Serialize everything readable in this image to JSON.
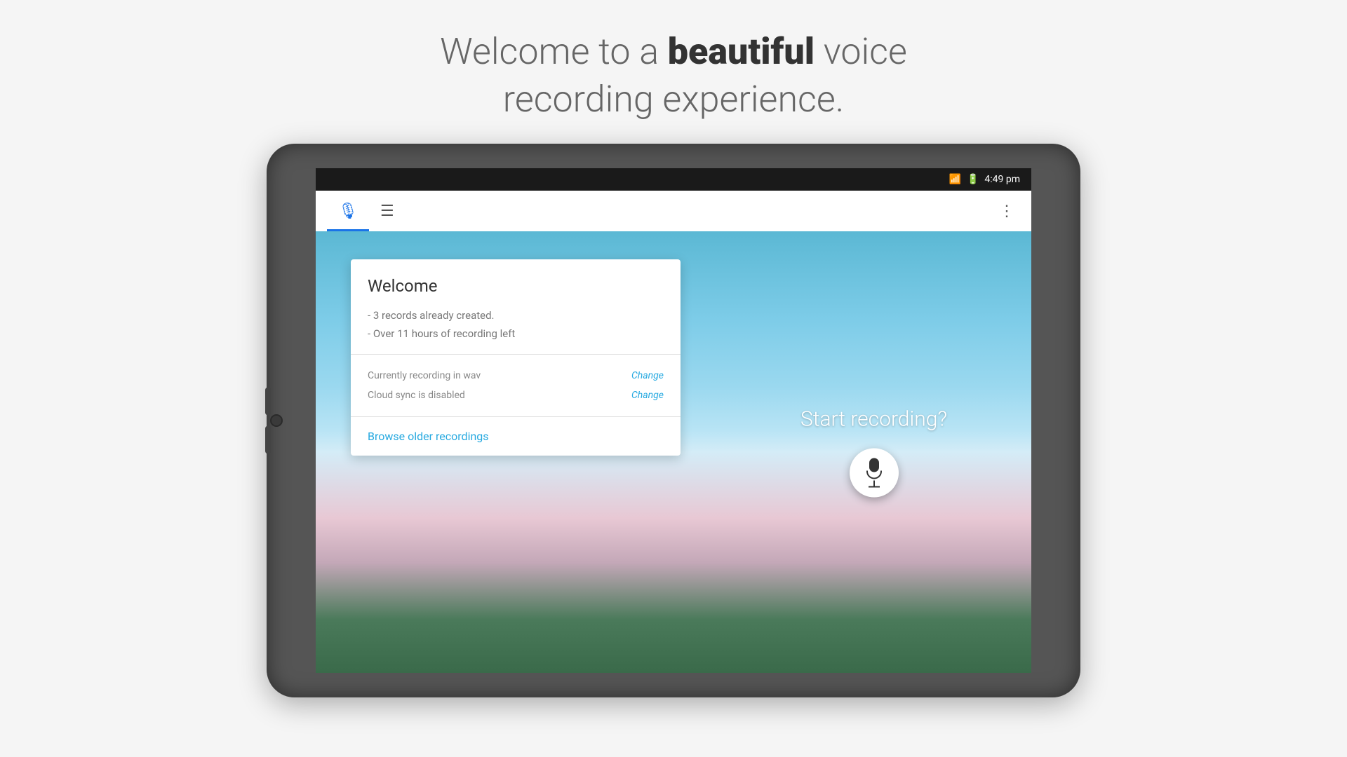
{
  "header": {
    "line1_pre": "Welcome to a ",
    "line1_bold": "beautiful",
    "line1_post": " voice",
    "line2": "recording experience."
  },
  "status_bar": {
    "time": "4:49 pm",
    "wifi_icon": "wifi",
    "battery_icon": "battery"
  },
  "app_bar": {
    "tab_record_label": "Record tab",
    "tab_list_label": "List tab",
    "more_label": "More options"
  },
  "welcome_card": {
    "title": "Welcome",
    "info_line1": "- 3 records already created.",
    "info_line2": "- Over 11 hours of recording left",
    "setting1_label": "Currently recording in wav",
    "setting1_change": "Change",
    "setting2_label": "Cloud sync is disabled",
    "setting2_change": "Change",
    "browse_link": "Browse older recordings"
  },
  "record_section": {
    "prompt": "Start recording?",
    "button_label": "Record"
  }
}
